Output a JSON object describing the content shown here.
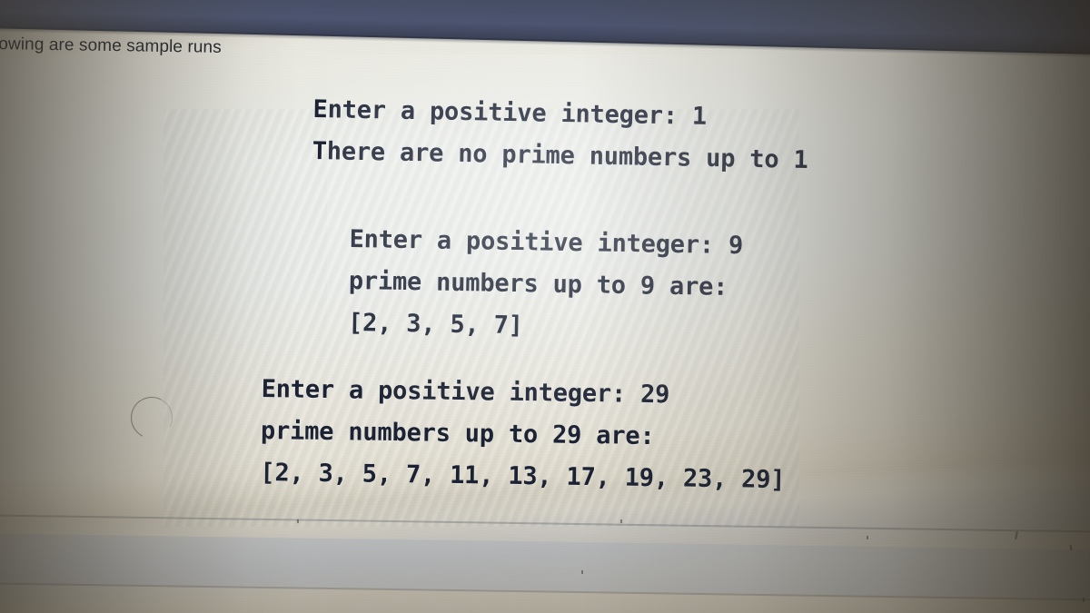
{
  "photo": {
    "kind": "photo-of-screen",
    "surface_color": "#e9ebe6",
    "text_color": "#1b2233",
    "bezel_color": "#464e64",
    "band_color": "#c2c8d2"
  },
  "header": {
    "text": "lowing are some sample runs"
  },
  "console": {
    "blocks": [
      {
        "id": "sample-run-1",
        "prompt_label": "Enter a positive integer:",
        "input_value": "1",
        "line_1": "Enter a positive integer: 1",
        "line_2": "There are no prime numbers up to 1",
        "line_3": ""
      },
      {
        "id": "sample-run-2",
        "prompt_label": "Enter a positive integer:",
        "input_value": "9",
        "line_1": "Enter a positive integer: 9",
        "line_2": "prime numbers up to 9 are:",
        "line_3": "[2, 3, 5, 7]"
      },
      {
        "id": "sample-run-3",
        "prompt_label": "Enter a positive integer:",
        "input_value": "29",
        "line_1": "Enter a positive integer: 29",
        "line_2": "prime numbers up to 29 are:",
        "line_3": "[2, 3, 5, 7, 11, 13, 17, 19, 23, 29]"
      }
    ]
  }
}
